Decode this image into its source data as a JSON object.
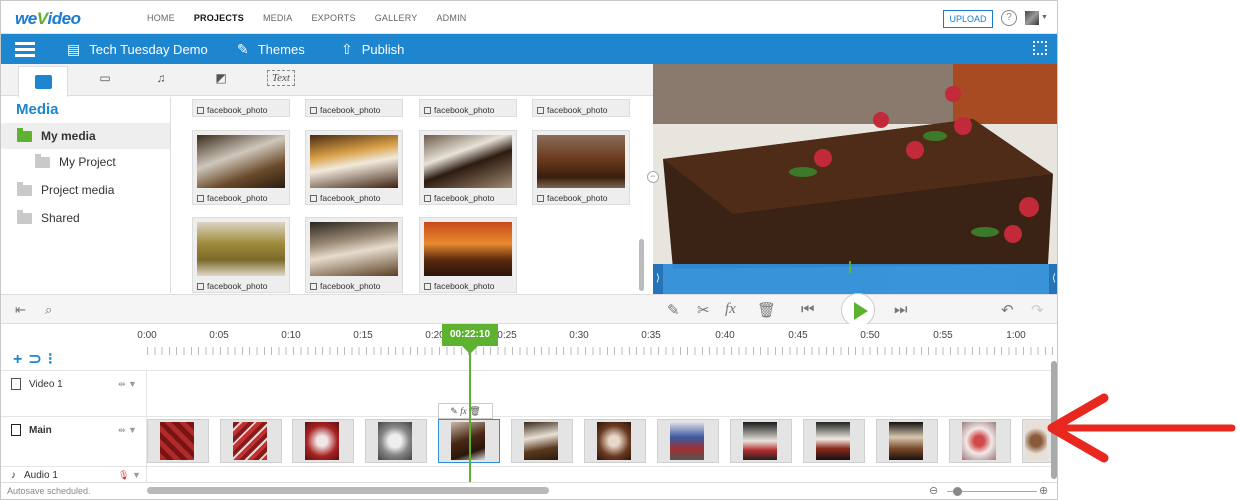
{
  "app": {
    "logo": "WeVideo"
  },
  "topnav": {
    "links": [
      "HOME",
      "PROJECTS",
      "MEDIA",
      "EXPORTS",
      "GALLERY",
      "ADMIN"
    ],
    "active": "PROJECTS",
    "upload_label": "UPLOAD",
    "help_label": "?"
  },
  "bluebar": {
    "project_title": "Tech Tuesday Demo",
    "themes_label": "Themes",
    "publish_label": "Publish"
  },
  "library": {
    "text_tab_label": "Text",
    "sidebar_title": "Media",
    "sidebar_items": [
      "My media",
      "My Project",
      "Project media",
      "Shared"
    ],
    "tile_caption": "facebook_photo",
    "tiles_top_row": [
      "facebook_photo",
      "facebook_photo",
      "facebook_photo",
      "facebook_photo"
    ]
  },
  "ruler": {
    "labels": [
      "0:00",
      "0:05",
      "0:10",
      "0:15",
      "0:20",
      "0:25",
      "0:30",
      "0:35",
      "0:40",
      "0:45",
      "0:50",
      "0:55",
      "1:00"
    ],
    "playhead_time": "00:22:10"
  },
  "tracks": [
    {
      "name": "Video 1"
    },
    {
      "name": "Main"
    },
    {
      "name": "Audio 1"
    }
  ],
  "status": {
    "text": "Autosave scheduled."
  },
  "colors": {
    "brand_blue": "#1e86cf",
    "accent_green": "#5db330",
    "annotation_red": "#e8281f"
  }
}
